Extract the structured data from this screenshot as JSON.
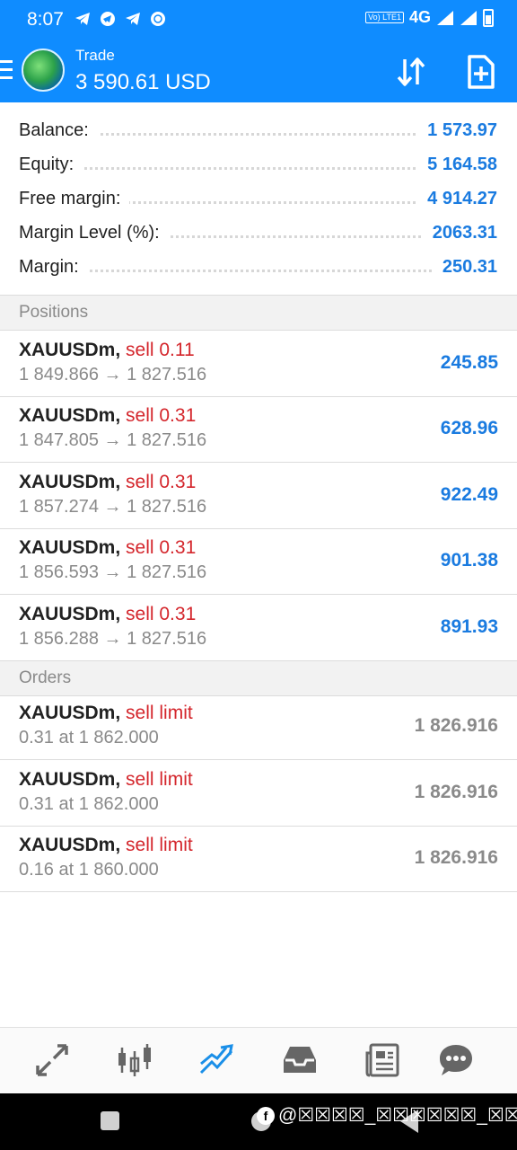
{
  "status_bar": {
    "time": "8:07",
    "network": "4G",
    "volte_label": "Vo) LTE1"
  },
  "header": {
    "title": "Trade",
    "subtitle": "3 590.61 USD"
  },
  "summary": [
    {
      "label": "Balance:",
      "value": "1 573.97"
    },
    {
      "label": "Equity:",
      "value": "5 164.58"
    },
    {
      "label": "Free margin:",
      "value": "4 914.27"
    },
    {
      "label": "Margin Level (%):",
      "value": "2063.31"
    },
    {
      "label": "Margin:",
      "value": "250.31"
    }
  ],
  "positions": {
    "title": "Positions",
    "items": [
      {
        "symbol": "XAUUSDm,",
        "side": "sell 0.11",
        "prices": "1 849.866 → 1 827.516",
        "profit": "245.85"
      },
      {
        "symbol": "XAUUSDm,",
        "side": "sell 0.31",
        "prices": "1 847.805 → 1 827.516",
        "profit": "628.96"
      },
      {
        "symbol": "XAUUSDm,",
        "side": "sell 0.31",
        "prices": "1 857.274 → 1 827.516",
        "profit": "922.49"
      },
      {
        "symbol": "XAUUSDm,",
        "side": "sell 0.31",
        "prices": "1 856.593 → 1 827.516",
        "profit": "901.38"
      },
      {
        "symbol": "XAUUSDm,",
        "side": "sell 0.31",
        "prices": "1 856.288 → 1 827.516",
        "profit": "891.93"
      }
    ]
  },
  "orders": {
    "title": "Orders",
    "items": [
      {
        "symbol": "XAUUSDm,",
        "side": "sell limit",
        "detail": "0.31 at 1 862.000",
        "price": "1 826.916"
      },
      {
        "symbol": "XAUUSDm,",
        "side": "sell limit",
        "detail": "0.31 at 1 862.000",
        "price": "1 826.916"
      },
      {
        "symbol": "XAUUSDm,",
        "side": "sell limit",
        "detail": "0.16 at 1 860.000",
        "price": "1 826.916"
      }
    ]
  },
  "bottom_nav": [
    {
      "icon": "quotes-arrows-icon"
    },
    {
      "icon": "chart-candles-icon"
    },
    {
      "icon": "trade-icon",
      "active": true
    },
    {
      "icon": "history-inbox-icon"
    },
    {
      "icon": "news-icon"
    },
    {
      "icon": "messages-icon"
    }
  ],
  "watermark": "@☒☒☒☒_☒☒☒☒☒☒_☒☒",
  "colors": {
    "header_blue": "#0f8cff",
    "value_blue": "#1a7be0",
    "sell_red": "#d4262c",
    "muted_gray": "#8a8a8a"
  }
}
